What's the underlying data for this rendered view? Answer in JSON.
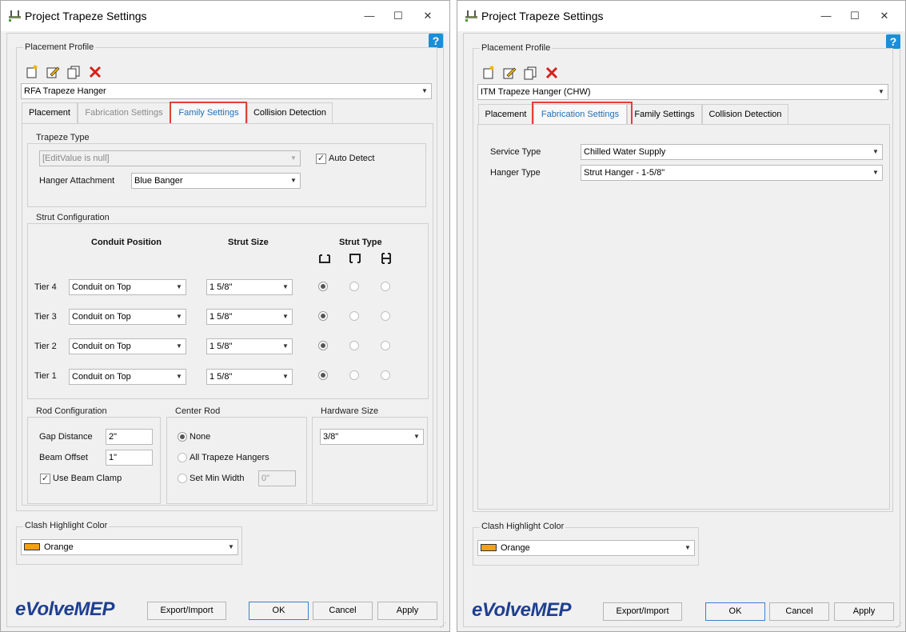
{
  "colors": {
    "accent": "#1d6fb8",
    "highlight": "#e0403a",
    "swatch_orange": "#f6a018",
    "logo": "#1f3f8f",
    "help": "#1a8fd8"
  },
  "left": {
    "title": "Project Trapeze Settings",
    "window_controls": {
      "minimize": "—",
      "maximize": "☐",
      "close": "✕"
    },
    "help": "?",
    "placement_profile_label": "Placement Profile",
    "profile_value": "RFA Trapeze Hanger",
    "tabs": [
      "Placement",
      "Fabrication Settings",
      "Family Settings",
      "Collision Detection"
    ],
    "active_tab": "Family Settings",
    "trapeze_type": {
      "label": "Trapeze Type",
      "value": "[EditValue is null]",
      "auto_detect": "Auto Detect",
      "auto_detect_checked": true,
      "hanger_attachment_label": "Hanger Attachment",
      "hanger_attachment": "Blue Banger"
    },
    "strut": {
      "label": "Strut Configuration",
      "col_position": "Conduit Position",
      "col_size": "Strut Size",
      "col_type": "Strut Type",
      "tiers": [
        {
          "name": "Tier 4",
          "position": "Conduit on Top",
          "size": "1 5/8\""
        },
        {
          "name": "Tier 3",
          "position": "Conduit on Top",
          "size": "1 5/8\""
        },
        {
          "name": "Tier 2",
          "position": "Conduit on Top",
          "size": "1 5/8\""
        },
        {
          "name": "Tier 1",
          "position": "Conduit on Top",
          "size": "1 5/8\""
        }
      ]
    },
    "rod": {
      "label": "Rod Configuration",
      "gap_label": "Gap Distance",
      "gap": "2\"",
      "offset_label": "Beam Offset",
      "offset": "1\"",
      "beam_clamp": "Use Beam Clamp",
      "beam_clamp_checked": true
    },
    "center_rod": {
      "label": "Center Rod",
      "none": "None",
      "all": "All Trapeze Hangers",
      "setmin": "Set Min Width",
      "setmin_value": "0\""
    },
    "hardware": {
      "label": "Hardware Size",
      "value": "3/8\""
    },
    "clash": {
      "label": "Clash Highlight Color",
      "value": "Orange"
    },
    "logo": "eVolveMEP",
    "buttons": {
      "export": "Export/Import",
      "ok": "OK",
      "cancel": "Cancel",
      "apply": "Apply"
    }
  },
  "right": {
    "title": "Project Trapeze Settings",
    "window_controls": {
      "minimize": "—",
      "maximize": "☐",
      "close": "✕"
    },
    "help": "?",
    "placement_profile_label": "Placement Profile",
    "profile_value": "ITM Trapeze Hanger (CHW)",
    "tabs": [
      "Placement",
      "Fabrication Settings",
      "Family Settings",
      "Collision Detection"
    ],
    "active_tab": "Fabrication Settings",
    "service_type_label": "Service Type",
    "service_type": "Chilled Water Supply",
    "hanger_type_label": "Hanger Type",
    "hanger_type": "Strut Hanger - 1-5/8\"",
    "clash": {
      "label": "Clash Highlight Color",
      "value": "Orange"
    },
    "logo": "eVolveMEP",
    "buttons": {
      "export": "Export/Import",
      "ok": "OK",
      "cancel": "Cancel",
      "apply": "Apply"
    }
  }
}
